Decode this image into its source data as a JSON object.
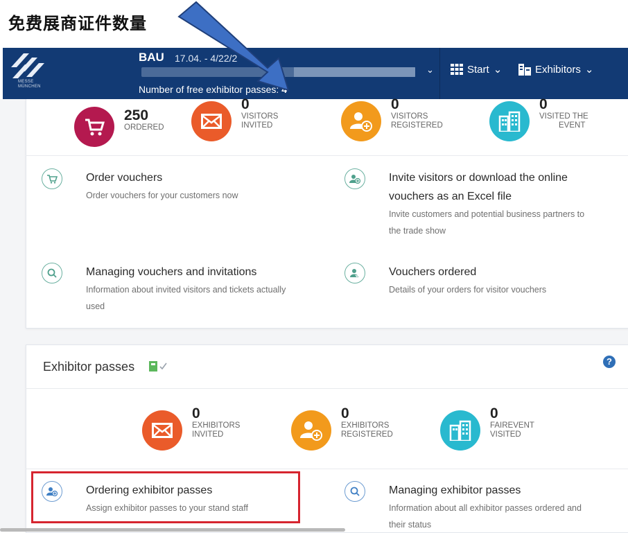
{
  "caption": "免费展商证件数量",
  "header": {
    "logo_text_line1": "MESSE",
    "logo_text_line2": "MÜNCHEN",
    "event_name": "BAU",
    "event_date": "17.04. - 4/22/2",
    "free_passes_label": "Number of free exhibitor passes:",
    "free_passes_count": "4",
    "nav_start": "Start",
    "nav_exhibitors": "Exhibitors"
  },
  "visitor_stats": [
    {
      "value": "250",
      "label1": "ORDERED",
      "label2": "",
      "color": "#b4194f"
    },
    {
      "value": "0",
      "label1": "VISITORS",
      "label2": "INVITED",
      "color": "#ea5b2a"
    },
    {
      "value": "0",
      "label1": "VISITORS",
      "label2": "REGISTERED",
      "color": "#f29a1c"
    },
    {
      "value": "0",
      "label1": "VISITED THE",
      "label2": "EVENT",
      "color": "#29b9cf"
    }
  ],
  "visitor_actions": [
    {
      "title": "Order vouchers",
      "desc1": "Order vouchers for your customers now",
      "desc2": ""
    },
    {
      "title1": "Invite visitors or download the online",
      "title2": "vouchers as an Excel file",
      "desc1": "Invite customers and potential business partners to",
      "desc2": "the trade show"
    },
    {
      "title": "Managing vouchers and invitations",
      "desc1": "Information about invited visitors and tickets actually",
      "desc2": "used"
    },
    {
      "title": "Vouchers ordered",
      "desc1": "Details of your orders for visitor vouchers",
      "desc2": ""
    }
  ],
  "exhibitor_section": {
    "title": "Exhibitor passes",
    "help": "?",
    "stats": [
      {
        "value": "0",
        "label1": "EXHIBITORS",
        "label2": "INVITED",
        "color": "#ea5b2a"
      },
      {
        "value": "0",
        "label1": "EXHIBITORS",
        "label2": "REGISTERED",
        "color": "#f29a1c"
      },
      {
        "value": "0",
        "label1": "FAIREVENT",
        "label2": "VISITED",
        "color": "#29b9cf"
      }
    ],
    "actions": [
      {
        "title": "Ordering exhibitor passes",
        "desc1": "Assign exhibitor passes to your stand staff",
        "desc2": ""
      },
      {
        "title": "Managing exhibitor passes",
        "desc1": "Information about all exhibitor passes ordered and",
        "desc2": "their status"
      }
    ]
  }
}
